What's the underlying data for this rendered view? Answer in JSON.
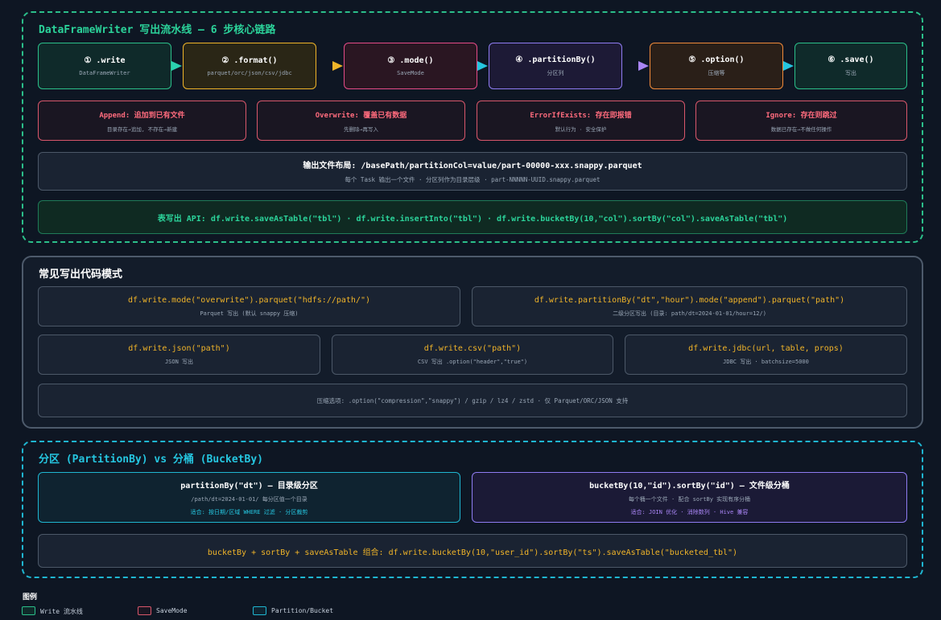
{
  "pipeline": {
    "title": "DataFrameWriter 写出流水线 — 6 步核心链路",
    "steps": [
      {
        "title": "① .write",
        "sub": "DataFrameWriter"
      },
      {
        "title": "② .format()",
        "sub": "parquet/orc/json/csv/jdbc"
      },
      {
        "title": "③ .mode()",
        "sub": "SaveMode"
      },
      {
        "title": "④ .partitionBy()",
        "sub": "分区列"
      },
      {
        "title": "⑤ .option()",
        "sub": "压缩等"
      },
      {
        "title": "⑥ .save()",
        "sub": "写出"
      }
    ],
    "modes": [
      {
        "title": "Append: 追加到已有文件",
        "sub": "目录存在→追加, 不存在→新建"
      },
      {
        "title": "Overwrite: 覆盖已有数据",
        "sub": "先删除→再写入"
      },
      {
        "title": "ErrorIfExists: 存在即报错",
        "sub": "默认行为 · 安全保护"
      },
      {
        "title": "Ignore: 存在则跳过",
        "sub": "数据已存在→不做任何操作"
      }
    ],
    "layout": {
      "title": "输出文件布局: /basePath/partitionCol=value/part-00000-xxx.snappy.parquet",
      "sub": "每个 Task 输出一个文件 · 分区列作为目录层级 · part-NNNNN-UUID.snappy.parquet"
    },
    "table_api": "表写出 API: df.write.saveAsTable(\"tbl\") · df.write.insertInto(\"tbl\") · df.write.bucketBy(10,\"col\").sortBy(\"col\").saveAsTable(\"tbl\")"
  },
  "patterns": {
    "title": "常见写出代码模式",
    "row1": [
      {
        "code": "df.write.mode(\"overwrite\").parquet(\"hdfs://path/\")",
        "desc": "Parquet 写出 (默认 snappy 压缩)"
      },
      {
        "code": "df.write.partitionBy(\"dt\",\"hour\").mode(\"append\").parquet(\"path\")",
        "desc": "二级分区写出 (目录: path/dt=2024-01-01/hour=12/)"
      }
    ],
    "row2": [
      {
        "code": "df.write.json(\"path\")",
        "desc": "JSON 写出"
      },
      {
        "code": "df.write.csv(\"path\")",
        "desc": "CSV 写出 .option(\"header\",\"true\")"
      },
      {
        "code": "df.write.jdbc(url, table, props)",
        "desc": "JDBC 写出 · batchsize=5000"
      }
    ],
    "compression": "压缩选项: .option(\"compression\",\"snappy\") / gzip / lz4 / zstd · 仅 Parquet/ORC/JSON 支持"
  },
  "partition": {
    "title": "分区 (PartitionBy) vs 分桶 (BucketBy)",
    "left": {
      "title": "partitionBy(\"dt\") — 目录级分区",
      "sub": "/path/dt=2024-01-01/ 每分区值一个目录",
      "note": "适合: 按日期/区域 WHERE 过滤 · 分区裁剪"
    },
    "right": {
      "title": "bucketBy(10,\"id\").sortBy(\"id\") — 文件级分桶",
      "sub": "每个桶一个文件 · 配合 sortBy 实现有序分桶",
      "note": "适合: JOIN 优化 · 消除数列 · Hive 兼容"
    },
    "combo": "bucketBy + sortBy + saveAsTable 组合: df.write.bucketBy(10,\"user_id\").sortBy(\"ts\").saveAsTable(\"bucketed_tbl\")"
  },
  "legend": {
    "title": "图例",
    "items": [
      {
        "label": "Write 流水线",
        "color": "#2bbf8a"
      },
      {
        "label": "SaveMode",
        "color": "#d9576b"
      },
      {
        "label": "Partition/Bucket",
        "color": "#1fb6d1"
      }
    ]
  },
  "colors": {
    "green": "#2bbf8a",
    "amber": "#f0b429",
    "pink": "#e54b87",
    "purple": "#8f7cf2",
    "orange": "#f08a3a",
    "cyan": "#1fb6d1",
    "red": "#d9576b"
  }
}
